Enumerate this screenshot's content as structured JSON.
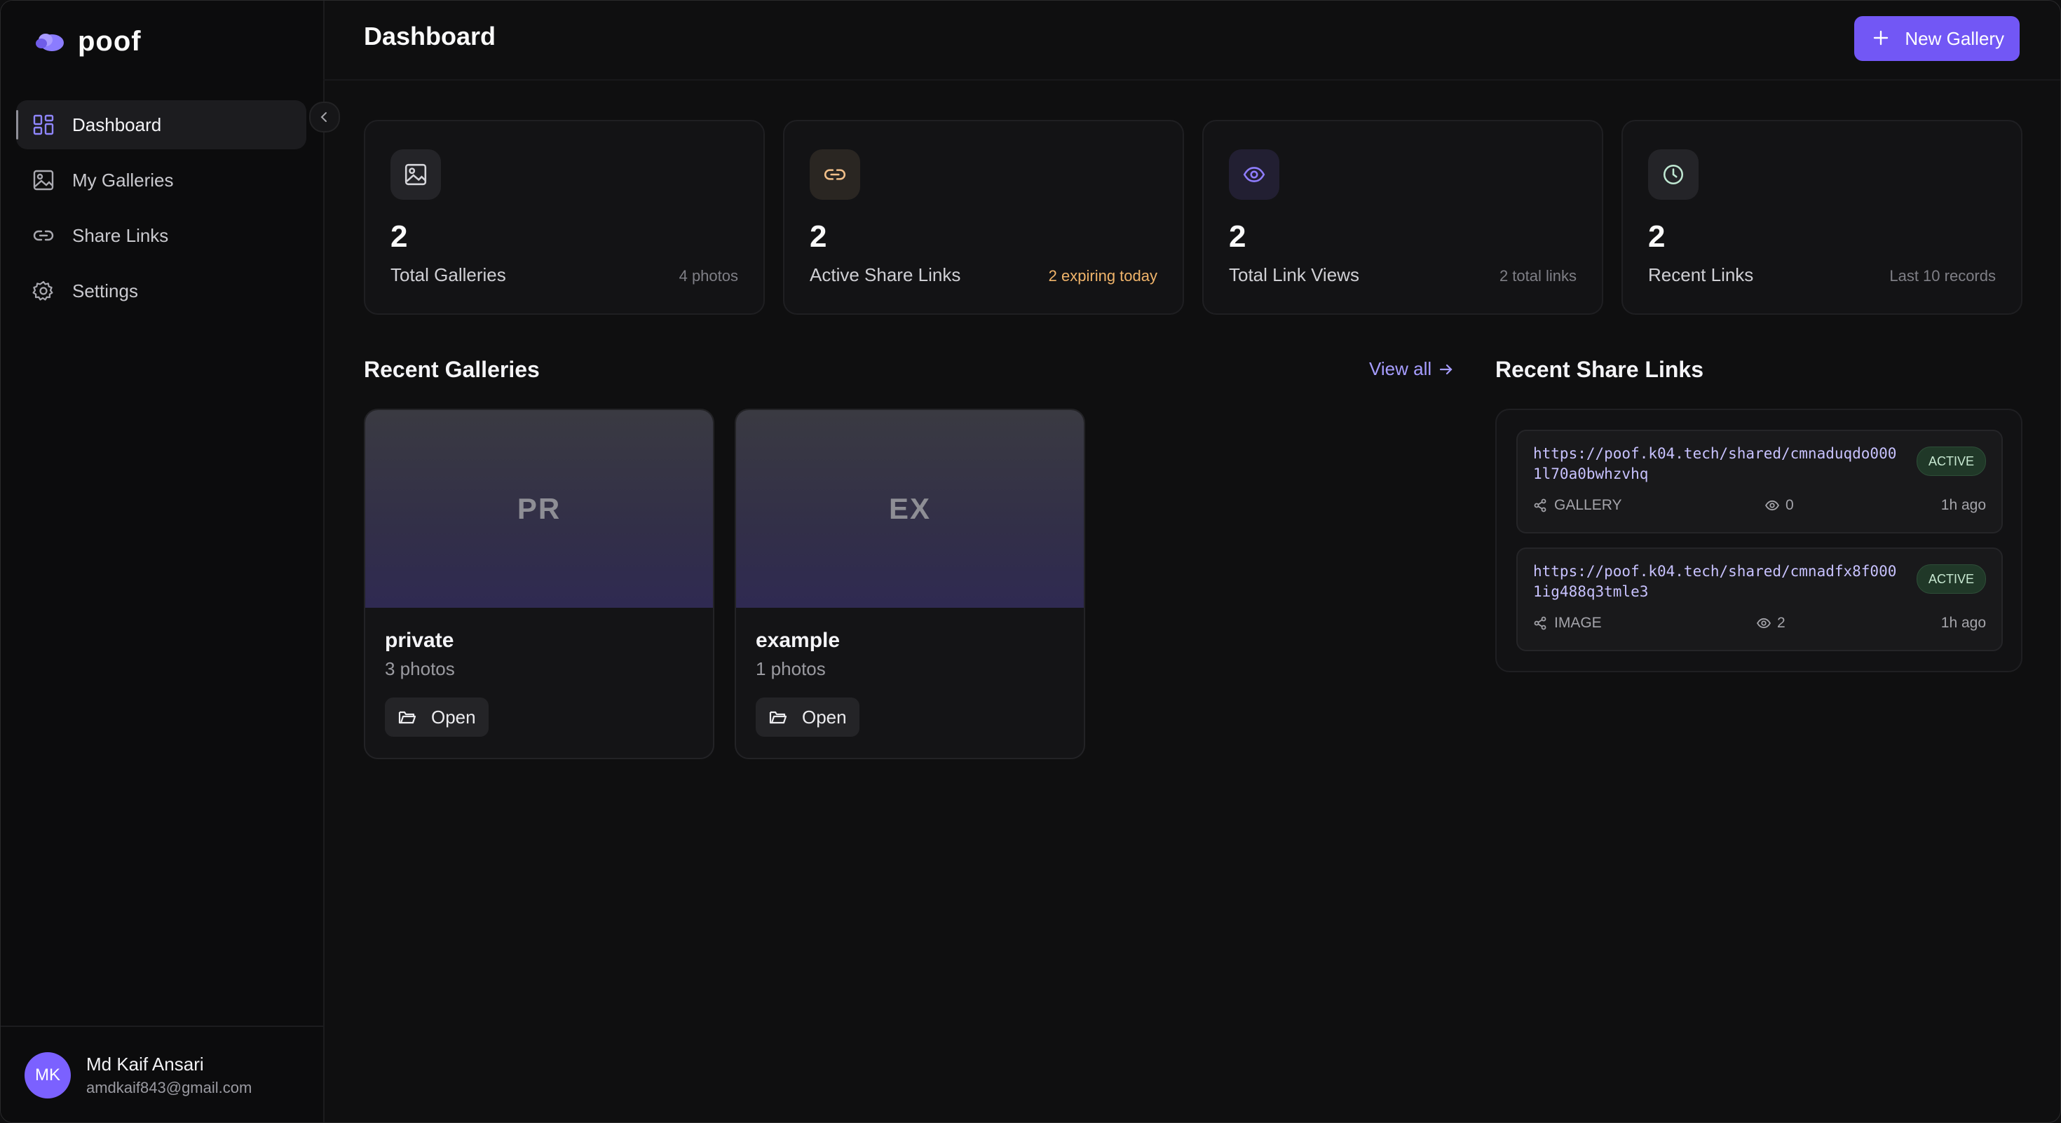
{
  "brand": {
    "name": "poof"
  },
  "sidebar": {
    "items": [
      {
        "label": "Dashboard",
        "icon": "grid-icon",
        "active": true
      },
      {
        "label": "My Galleries",
        "icon": "image-icon",
        "active": false
      },
      {
        "label": "Share Links",
        "icon": "link-icon",
        "active": false
      },
      {
        "label": "Settings",
        "icon": "gear-icon",
        "active": false
      }
    ],
    "user": {
      "initials": "MK",
      "name": "Md Kaif Ansari",
      "email": "amdkaif843@gmail.com"
    }
  },
  "header": {
    "title": "Dashboard",
    "new_gallery_label": "New Gallery"
  },
  "stats": [
    {
      "value": "2",
      "label": "Total Galleries",
      "meta": "4 photos",
      "icon": "image-icon"
    },
    {
      "value": "2",
      "label": "Active Share Links",
      "meta": "2 expiring today",
      "icon": "link-icon"
    },
    {
      "value": "2",
      "label": "Total Link Views",
      "meta": "2 total links",
      "icon": "eye-icon"
    },
    {
      "value": "2",
      "label": "Recent Links",
      "meta": "Last 10 records",
      "icon": "clock-icon"
    }
  ],
  "recent_galleries": {
    "title": "Recent Galleries",
    "view_all_label": "View all",
    "items": [
      {
        "initials": "PR",
        "name": "private",
        "count": "3 photos",
        "open_label": "Open"
      },
      {
        "initials": "EX",
        "name": "example",
        "count": "1 photos",
        "open_label": "Open"
      }
    ]
  },
  "recent_links": {
    "title": "Recent Share Links",
    "items": [
      {
        "url": "https://poof.k04.tech/shared/cmnaduqdo0001l70a0bwhzvhq",
        "status": "ACTIVE",
        "type": "GALLERY",
        "views": "0",
        "time": "1h ago"
      },
      {
        "url": "https://poof.k04.tech/shared/cmnadfx8f0001ig488q3tmle3",
        "status": "ACTIVE",
        "type": "IMAGE",
        "views": "2",
        "time": "1h ago"
      }
    ]
  },
  "colors": {
    "accent": "#7257f5",
    "link_text": "#c8c2ff",
    "warning": "#f0b46a",
    "active_badge_bg": "#203828"
  }
}
